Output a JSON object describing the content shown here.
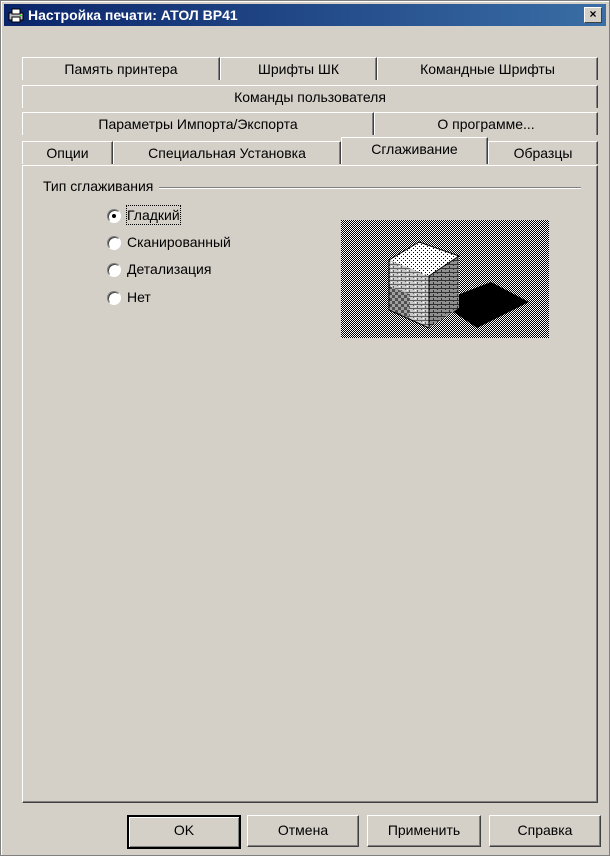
{
  "window": {
    "title": "Настройка печати: АТОЛ BP41",
    "close_label": "×"
  },
  "tabs": {
    "row1": [
      "Память принтера",
      "Шрифты ШК",
      "Командные Шрифты"
    ],
    "row2": [
      "Команды пользователя"
    ],
    "row3": [
      "Параметры Импорта/Экспорта",
      "О программе..."
    ],
    "row4": [
      "Опции",
      "Специальная Установка",
      "Сглаживание",
      "Образцы"
    ],
    "active": "Сглаживание"
  },
  "smoothing": {
    "group_label": "Тип сглаживания",
    "options": [
      "Гладкий",
      "Сканированный",
      "Детализация",
      "Нет"
    ],
    "selected": "Гладкий"
  },
  "buttons": {
    "ok": "OK",
    "cancel": "Отмена",
    "apply": "Применить",
    "help": "Справка"
  },
  "colors": {
    "title_start": "#0a246a",
    "title_end": "#3a6ea5",
    "face": "#d4d0c8"
  }
}
